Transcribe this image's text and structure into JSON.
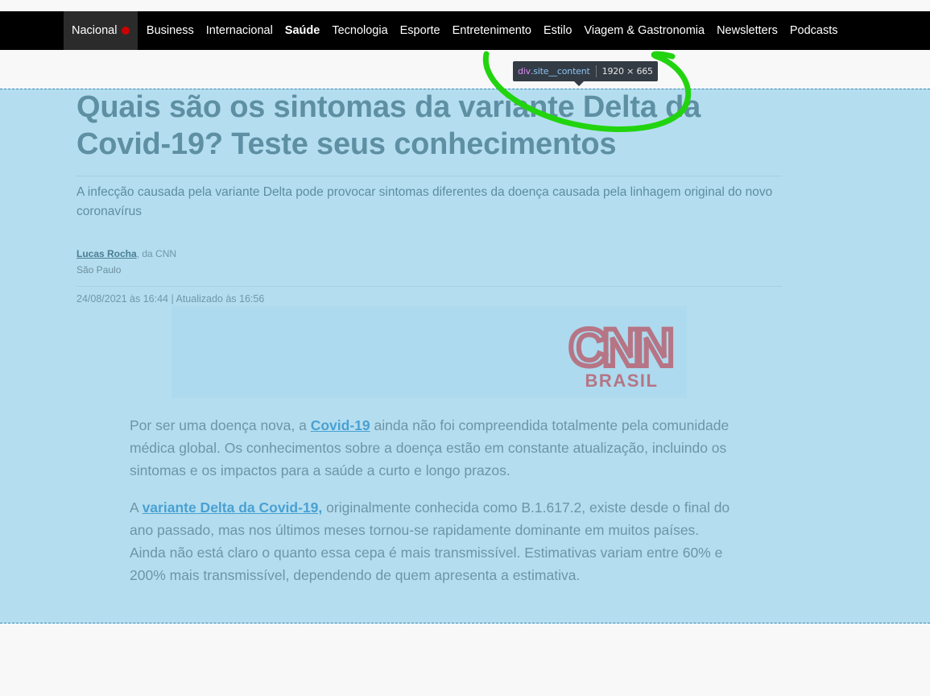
{
  "nav": {
    "items": [
      {
        "label": "Nacional",
        "live": true
      },
      {
        "label": "Business"
      },
      {
        "label": "Internacional"
      },
      {
        "label": "Saúde",
        "bold": true
      },
      {
        "label": "Tecnologia"
      },
      {
        "label": "Esporte"
      },
      {
        "label": "Entretenimento"
      },
      {
        "label": "Estilo"
      },
      {
        "label": "Viagem & Gastronomia"
      },
      {
        "label": "Newsletters"
      },
      {
        "label": "Podcasts"
      }
    ]
  },
  "devtools": {
    "tag": "div",
    "class": ".site__content",
    "size": "1920 × 665"
  },
  "article": {
    "title": "Quais são os sintomas da variante Delta da Covid-19? Teste seus conhecimentos",
    "subtitle": "A infecção causada pela variante Delta pode provocar sintomas diferentes da doença causada pela linhagem original do novo coronavírus",
    "author": "Lucas Rocha",
    "author_suffix": ", da CNN",
    "location": "São Paulo",
    "timestamp": "24/08/2021 às 16:44 | Atualizado às 16:56",
    "p1": {
      "before": "Por ser uma doença nova, a ",
      "link": "Covid-19",
      "after": " ainda não foi compreendida totalmente pela comunidade médica global. Os conhecimentos sobre a doença estão em constante atualização, incluindo os sintomas e os impactos para a saúde a curto e longo prazos."
    },
    "p2": {
      "before": "A ",
      "link": "variante Delta da Covid-19,",
      "after": " originalmente conhecida como B.1.617.2, existe desde o final do ano passado, mas nos últimos meses tornou-se rapidamente dominante em muitos países. Ainda não está claro o quanto essa cepa é mais transmissível. Estimativas variam entre 60% e 200% mais transmissível, dependendo de quem apresenta a estimativa."
    }
  },
  "logo": {
    "wordmark": "CNN",
    "sub": "BRASIL"
  },
  "colors": {
    "overlay": "#b4def0",
    "nav_bg": "#000000",
    "live_dot": "#cc0000",
    "annotation": "#22d40f",
    "logo": "#b67585"
  }
}
